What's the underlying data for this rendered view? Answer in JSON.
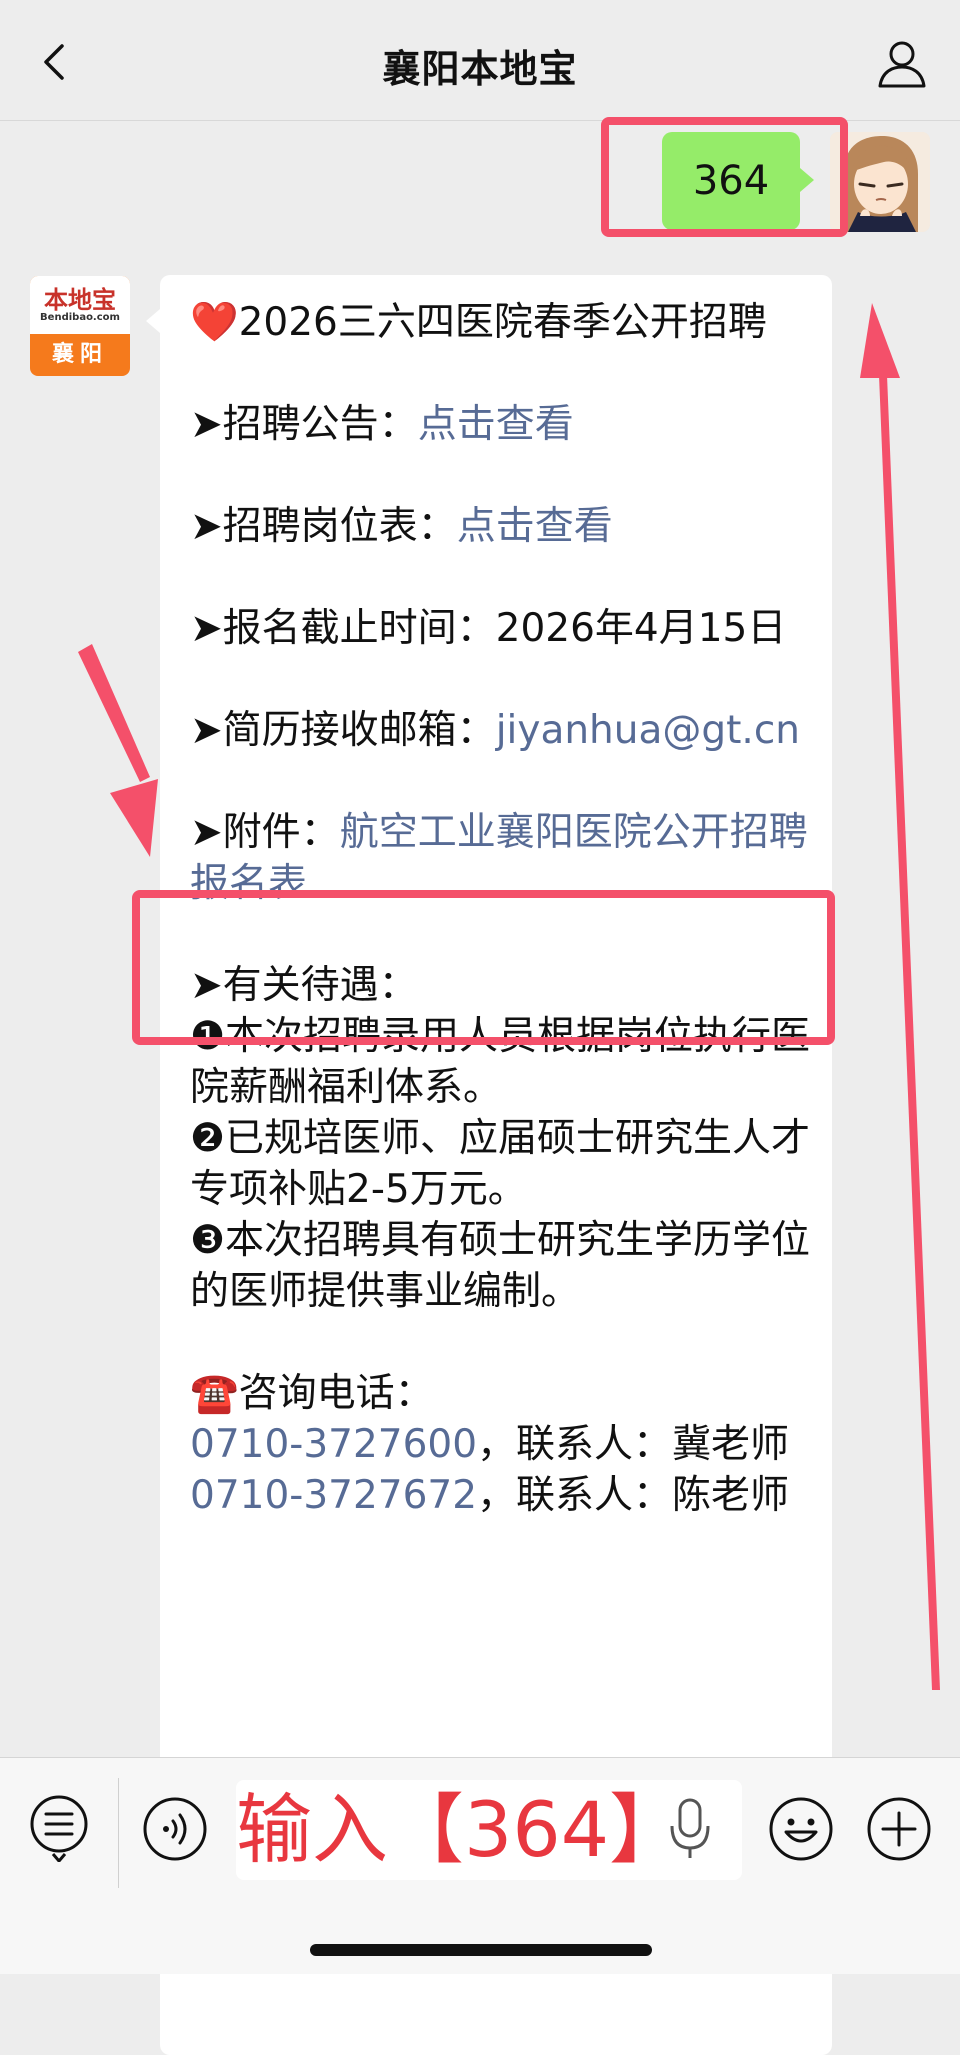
{
  "header": {
    "title": "襄阳本地宝"
  },
  "user_message": {
    "text": "364"
  },
  "bot_avatar": {
    "brand": "本地宝",
    "site": "Bendibao.com",
    "city": "襄阳"
  },
  "message": {
    "title_emoji": "❤️",
    "title": "2026三六四医院春季公开招聘",
    "notice_label": "➤招聘公告：",
    "notice_link": "点击查看",
    "positions_label": "➤招聘岗位表：",
    "positions_link": "点击查看",
    "deadline": "➤报名截止时间：2026年4月15日",
    "email_label": "➤简历接收邮箱：",
    "email": "jiyanhua@gt.cn",
    "attachment_label": "➤附件：",
    "attachment_link": "航空工业襄阳医院公开招聘报名表",
    "benefits_label": "➤有关待遇：",
    "benefit_1": "❶本次招聘录用人员根据岗位执行医院薪酬福利体系。",
    "benefit_2": "❷已规培医师、应届硕士研究生人才专项补贴2-5万元。",
    "benefit_3": "❸本次招聘具有硕士研究生学历学位的医师提供事业编制。",
    "contact_icon": "☎️",
    "contact_label": "咨询电话：",
    "phone_1": "0710-3727600",
    "contact_1": "，联系人：冀老师",
    "phone_2": "0710-3727672",
    "contact_2": "，联系人：陈老师"
  },
  "input": {
    "overlay_text": "输入【364】"
  },
  "colors": {
    "highlight": "#f4506a",
    "link": "#576b95",
    "user_bubble": "#95ec69"
  }
}
